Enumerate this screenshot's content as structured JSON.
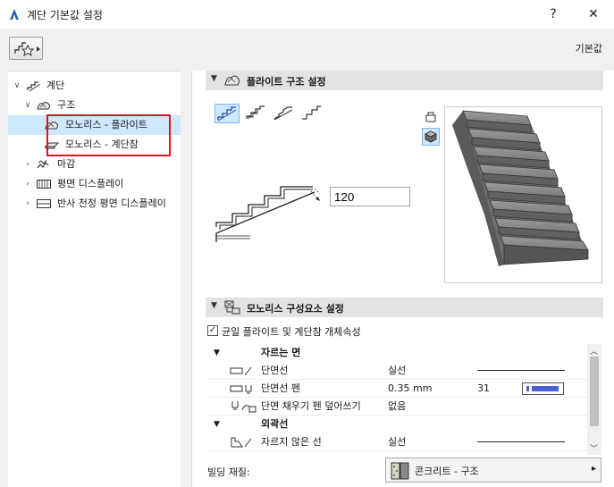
{
  "window": {
    "title": "계단 기본값 설정",
    "help": "?",
    "close": "✕"
  },
  "header": {
    "defaults_label": "기본값"
  },
  "tree": {
    "items": [
      {
        "label": "계단",
        "chevron": "∨"
      },
      {
        "label": "구조",
        "chevron": "∨"
      },
      {
        "label": "모노리스 - 플라이트"
      },
      {
        "label": "모노리스 - 계단참"
      },
      {
        "label": "마감",
        "chevron": "›"
      },
      {
        "label": "평면 디스플레이",
        "chevron": "›"
      },
      {
        "label": "반사 천정 평면 디스플레이",
        "chevron": "›"
      }
    ]
  },
  "flight_section": {
    "title": "플라이트 구조 설정",
    "thickness_value": "120"
  },
  "components_section": {
    "title": "모노리스 구성요소 설정",
    "uniform_label": "균일 플라이트 및 계단참 개체속성"
  },
  "grid": {
    "groups": [
      {
        "label": "자르는 면"
      },
      {
        "label": "외곽선"
      }
    ],
    "rows": [
      {
        "label": "단면선",
        "value": "실선"
      },
      {
        "label": "단면선 펜",
        "value": "0.35 mm",
        "extra": "31"
      },
      {
        "label": "단면 채우기 펜 덮어쓰기",
        "value": "없음"
      },
      {
        "label": "자르지 않은 선",
        "value": "실선"
      }
    ],
    "pen_color": "#4a5fd8"
  },
  "building_material": {
    "label": "빌딩 재질:",
    "value": "콘크리트 - 구조"
  },
  "colors": {
    "selection": "#cde8ff",
    "highlight_box": "#e0141e"
  }
}
